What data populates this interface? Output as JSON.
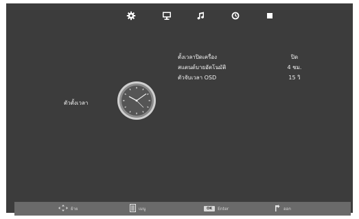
{
  "topbar": {
    "tabs": [
      {
        "icon": "gear-icon",
        "selected": true
      },
      {
        "icon": "monitor-icon",
        "selected": false
      },
      {
        "icon": "music-note-icon",
        "selected": false
      },
      {
        "icon": "timer-icon",
        "selected": false
      },
      {
        "icon": "stop-square-icon",
        "selected": false
      }
    ]
  },
  "category": {
    "label": "ตัวตั้งเวลา",
    "icon": "clock-icon"
  },
  "settings": {
    "items": [
      {
        "label": "ตั้งเวลาปิดเครื่อง",
        "value": "ปิด"
      },
      {
        "label": "สแตนด์บายอัตโนมัติ",
        "value": "4 ชม."
      },
      {
        "label": "ตัวจับเวลา OSD",
        "value": "15 วิ"
      }
    ]
  },
  "bottombar": {
    "move": {
      "icon": "dpad-arrows-icon",
      "label": "ย้าย"
    },
    "menu": {
      "icon": "menu-list-icon",
      "label": "เมนู"
    },
    "enter": {
      "key": "OK",
      "label": "Enter"
    },
    "exit": {
      "icon": "back-arrow-icon",
      "label": "ออก"
    }
  },
  "colors": {
    "panel_bg": "#3c3c3c",
    "bottombar_bg": "#6a6a6a",
    "text": "#f4f4f4"
  }
}
